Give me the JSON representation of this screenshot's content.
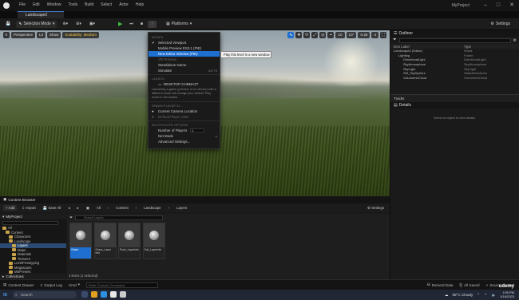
{
  "app": {
    "project_name": "MyProject",
    "menu": [
      "File",
      "Edit",
      "Window",
      "Tools",
      "Build",
      "Select",
      "Actor",
      "Help"
    ],
    "level_tab": "Landscape2"
  },
  "toolbar": {
    "save_icon": "save-icon",
    "selection_mode": "Selection Mode",
    "platforms": "Platforms",
    "settings": "Settings"
  },
  "viewport": {
    "perspective": "Perspective",
    "lit": "Lit",
    "show": "Show",
    "scalability": "Scalability: Medium",
    "snap_grid": "10",
    "snap_rot": "10°",
    "snap_scale": "0.25",
    "cam_speed": "4"
  },
  "play_menu": {
    "section_modes": "MODES",
    "items": {
      "selected_viewport": "Selected Viewport",
      "mobile_preview": "Mobile Preview ES3.1 (PIE)",
      "new_editor_window": "New Editor Window (PIE)",
      "vr_preview": "VR Preview",
      "standalone_game": "Standalone Game",
      "simulate": "Simulate",
      "simulate_shortcut": "ALT+S",
      "new_editor_shortcut": "",
      "device": "DESKTOP-CHBMA2T",
      "current_camera": "Current Camera Location",
      "default_player_start": "Default Player Start",
      "num_players_label": "Number of Players",
      "num_players_value": "1",
      "net_mode": "Net Mode",
      "advanced": "Advanced Settings..."
    },
    "section_launch": "LAUNCH",
    "launch_desc": "Launching a game (preview or on-device) with a different mode will change your default 'Play' mode in the toolbar",
    "section_spawn": "SPAWN PLAYER AT...",
    "section_multiplayer": "MULTIPLAYER OPTIONS",
    "tooltip": "Play this level in a new window"
  },
  "outliner": {
    "title": "Outliner",
    "col_label": "Item Label",
    "col_type": "Type",
    "rows": [
      {
        "label": "Landscape2 (Editor)",
        "type": "World"
      },
      {
        "label": "Lighting",
        "type": "Folder"
      },
      {
        "label": "DirectionalLight",
        "type": "DirectionalLight"
      },
      {
        "label": "SkyAtmosphere",
        "type": "SkyAtmosphere"
      },
      {
        "label": "SkyLight",
        "type": "SkyLight"
      },
      {
        "label": "SM_SkySphere",
        "type": "StaticMeshActor"
      },
      {
        "label": "VolumetricCloud",
        "type": "VolumetricCloud"
      }
    ]
  },
  "tracks": "Tracks",
  "details": {
    "title": "Details",
    "empty": "Select an object to view details."
  },
  "content_browser": {
    "tab": "Content Browser",
    "add": "Add",
    "import": "Import",
    "save_all": "Save All",
    "path": [
      "All",
      "Content",
      "Landscape",
      "Layers"
    ],
    "settings": "Settings",
    "project": "MyProject",
    "search_placeholder": "Search Layers",
    "tree": [
      {
        "label": "All",
        "depth": 0,
        "selected": false
      },
      {
        "label": "Content",
        "depth": 1,
        "selected": false
      },
      {
        "label": "Characters",
        "depth": 2,
        "selected": false
      },
      {
        "label": "Landscape",
        "depth": 2,
        "selected": false
      },
      {
        "label": "Layers",
        "depth": 3,
        "selected": true
      },
      {
        "label": "Maps",
        "depth": 3,
        "selected": false
      },
      {
        "label": "Materials",
        "depth": 3,
        "selected": false
      },
      {
        "label": "Textures",
        "depth": 3,
        "selected": false
      },
      {
        "label": "LevelPrototyping",
        "depth": 2,
        "selected": false
      },
      {
        "label": "Megascans",
        "depth": 2,
        "selected": false
      },
      {
        "label": "MSPresets",
        "depth": 2,
        "selected": false
      }
    ],
    "collections": "Collections",
    "assets": [
      {
        "label": "Grass",
        "selected": true
      },
      {
        "label": "Grass_Layer Info",
        "selected": false
      },
      {
        "label": "Rock_LayerInfo",
        "selected": false
      },
      {
        "label": "Soil_LayerInfo",
        "selected": false
      }
    ],
    "item_count": "4 items (1 selected)"
  },
  "statusbar": {
    "content_drawer": "Content Drawer",
    "output_log": "Output Log",
    "cmd": "Cmd",
    "cmd_placeholder": "Enter Console Command",
    "derived_data": "Derived Data",
    "all_saved": "All Saved",
    "source_control": "Source Control"
  },
  "taskbar": {
    "search": "Search",
    "weather": "59°C Cloudy",
    "time": "1:55 PM",
    "date": "1/16/2023",
    "watermark": "udemy"
  }
}
